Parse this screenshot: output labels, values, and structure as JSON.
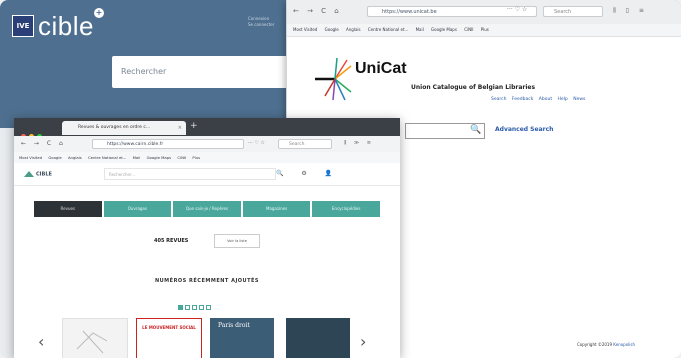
{
  "back_site": {
    "logo_mark": "IVE",
    "logo_text": "cible",
    "logo_plus": "+",
    "header_links": [
      "Connexion",
      "Se connecter"
    ],
    "search_placeholder": "Rechercher"
  },
  "unicat_window": {
    "nav_icons": "← → C ⌂",
    "url": "https://www.unicat.be",
    "url_extra": "··· ♡ ☆",
    "search_placeholder": "Search",
    "tools": "⫼ ▯ ≡",
    "bookmarks": [
      "Most Visited",
      "Google",
      "Anglais",
      "Centre National et...",
      "Mail",
      "Google Maps",
      "CiNII",
      "Plus"
    ],
    "site_name": "UniCat",
    "subtitle": "Union Catalogue of Belgian Libraries",
    "links": [
      "Search",
      "Feedback",
      "About",
      "Help",
      "News"
    ],
    "search_icon": "🔍",
    "advanced_search": "Advanced Search",
    "copyright_prefix": "Copyright ©2019",
    "copyright_owner": "Kenopolish"
  },
  "cible_window": {
    "tab_title": "Revues & ouvrages en ordre c...",
    "tab_close": "×",
    "new_tab": "+",
    "nav_icons": "← → C ⌂",
    "url": "https://www.cairn.cible.fr",
    "url_extra": "··· ♡ ☆",
    "search_placeholder": "Search",
    "tools": "⫼ ≫ ≡",
    "bookmarks": [
      "Most Visited",
      "Google",
      "Anglais",
      "Centre National et...",
      "Mail",
      "Google Maps",
      "CiNII",
      "Plus"
    ],
    "site_logo": "CIBLE",
    "site_search_placeholder": "Rechercher...",
    "site_icons": "🔍 ⚙ 👤",
    "nav_buttons": [
      "Revues",
      "Ouvrages",
      "Que sais-je / Repères",
      "Magazines",
      "Encyclopédies"
    ],
    "revues_count": "405 REVUES",
    "revues_button": "Voir la liste",
    "recent_title": "NUMÉROS RÉCEMMENT AJOUTÉS",
    "arrow_left": "‹",
    "arrow_right": "›",
    "covers": [
      {
        "title": ""
      },
      {
        "title": "LE MOUVEMENT SOCIAL"
      },
      {
        "title": "Paris droit"
      },
      {
        "title": ""
      }
    ]
  }
}
